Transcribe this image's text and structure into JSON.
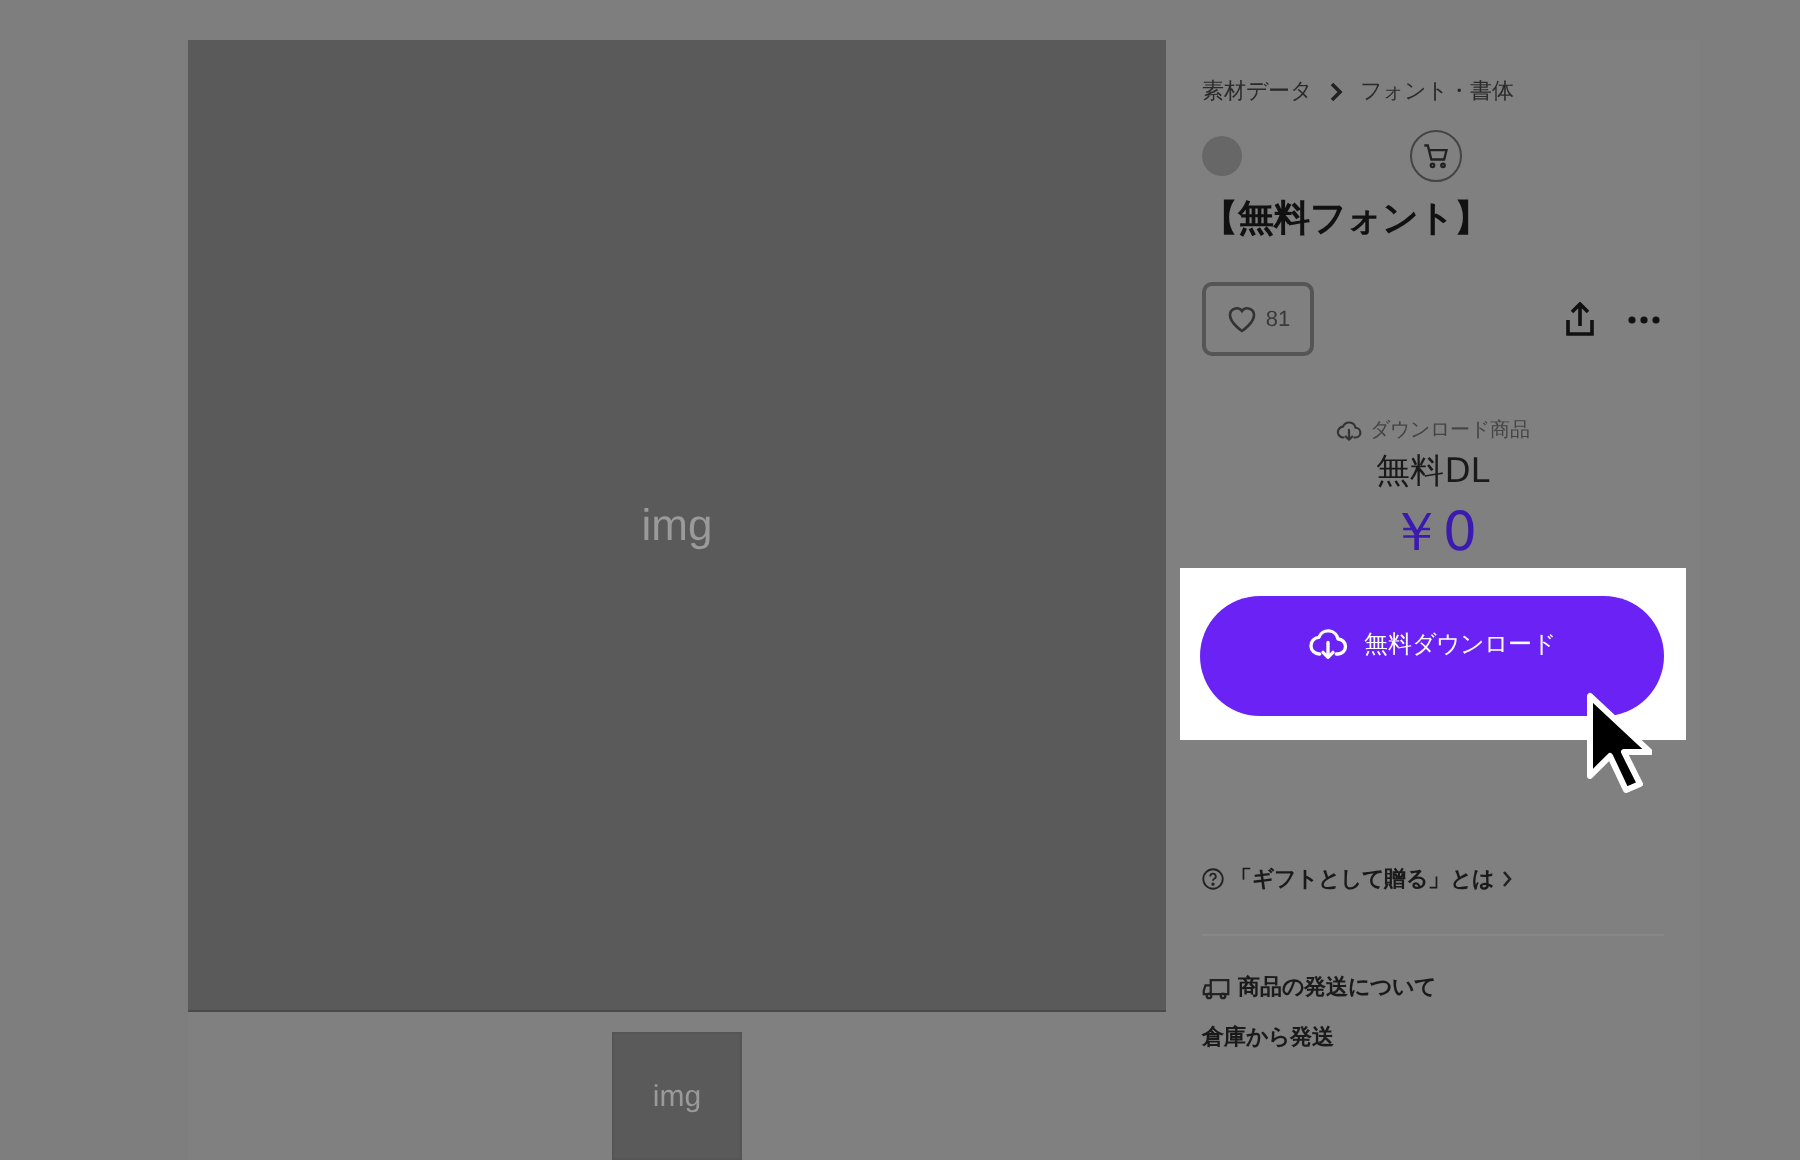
{
  "gallery": {
    "main_image": {
      "label": "img"
    },
    "thumbnails": [
      {
        "label": "img"
      }
    ]
  },
  "breadcrumb": [
    "素材データ",
    "フォント・書体"
  ],
  "title": "【無料フォント】",
  "like": {
    "count": "81"
  },
  "product": {
    "type": "ダウンロード商品",
    "price_label": "無料DL",
    "price": "￥0"
  },
  "download_button": {
    "label": "無料ダウンロード"
  },
  "gift_link": "「ギフトとして贈る」とは",
  "shipping": {
    "heading": "商品の発送について",
    "text": "倉庫から発送"
  }
}
